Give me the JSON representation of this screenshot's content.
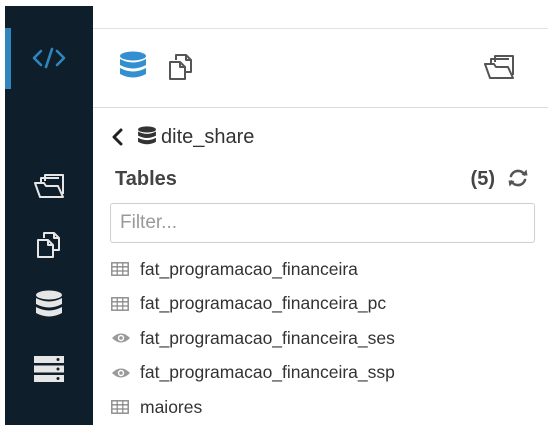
{
  "breadcrumb": {
    "database": "dite_share"
  },
  "tables_panel": {
    "title": "Tables",
    "count": "(5)"
  },
  "filter": {
    "placeholder": "Filter..."
  },
  "tables": [
    {
      "name": "fat_programacao_financeira",
      "kind": "table"
    },
    {
      "name": "fat_programacao_financeira_pc",
      "kind": "table"
    },
    {
      "name": "fat_programacao_financeira_ses",
      "kind": "view"
    },
    {
      "name": "fat_programacao_financeira_ssp",
      "kind": "view"
    },
    {
      "name": "maiores",
      "kind": "table"
    }
  ],
  "icons": {
    "sidebar": [
      "code-icon",
      "folder-icon",
      "documents-icon",
      "database-icon",
      "server-icon"
    ],
    "toolbar": [
      "database-icon",
      "documents-icon",
      "folder-icon"
    ]
  },
  "colors": {
    "sidebar_bg": "#0e1f2b",
    "accent": "#2f86bd",
    "active_icon": "#338fcf"
  }
}
